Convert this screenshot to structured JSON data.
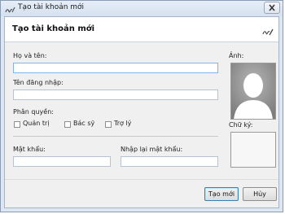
{
  "window": {
    "title": "Tạo tài khoản mới"
  },
  "header": {
    "title": "Tạo tài khoản mới"
  },
  "form": {
    "full_name_label": "Họ và tên:",
    "full_name_value": "",
    "username_label": "Tên đăng nhập:",
    "username_value": "",
    "role_label": "Phân quyền:",
    "roles": [
      {
        "label": "Quản trị",
        "checked": false
      },
      {
        "label": "Bác sỹ",
        "checked": false
      },
      {
        "label": "Trợ lý",
        "checked": false
      }
    ],
    "password_label": "Mật khẩu:",
    "password_value": "",
    "confirm_password_label": "Nhập lại mật khẩu:",
    "confirm_password_value": ""
  },
  "side": {
    "photo_label": "Ảnh:",
    "signature_label": "Chữ ký:"
  },
  "buttons": {
    "create_label": "Tạo mới",
    "cancel_label": "Hủy"
  },
  "icons": {
    "app": "signature-pen-icon",
    "header": "signature-pen-icon",
    "close": "close-icon",
    "photo": "person-placeholder-icon"
  }
}
